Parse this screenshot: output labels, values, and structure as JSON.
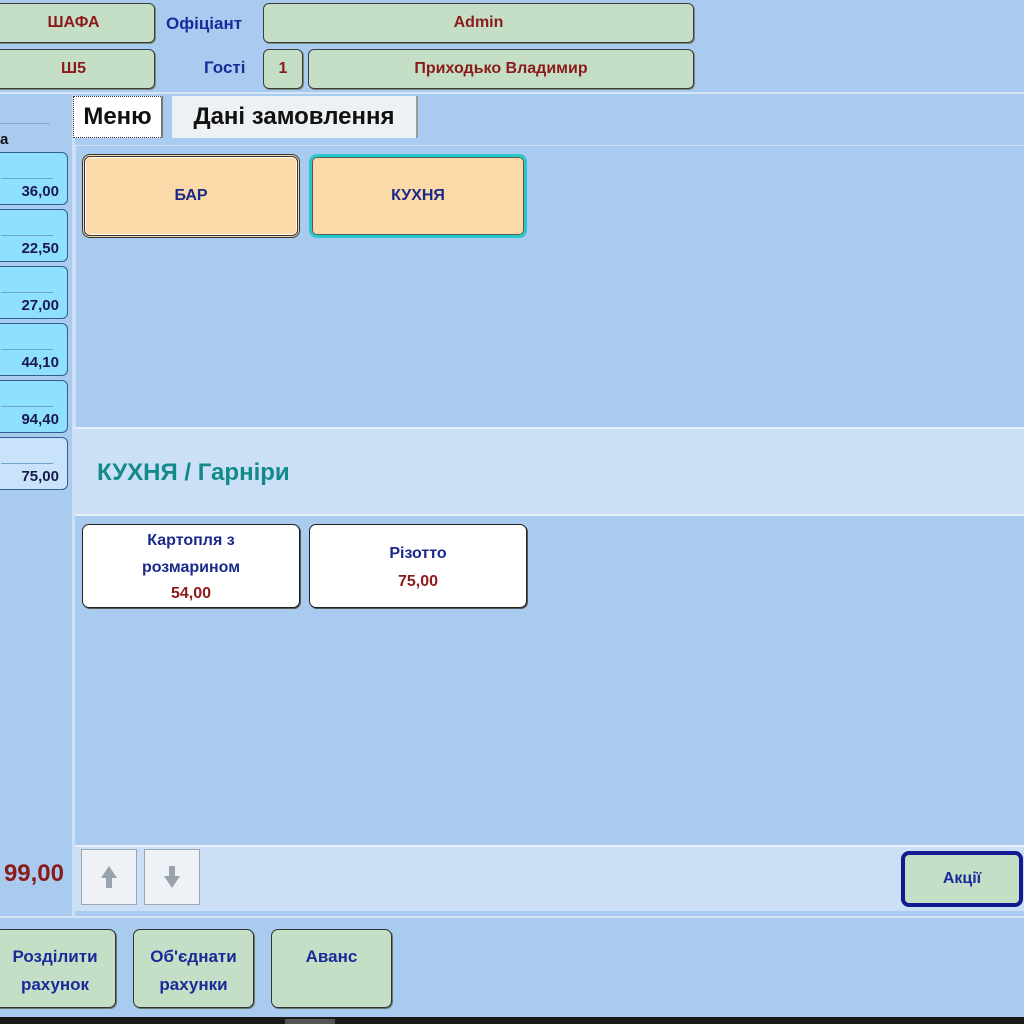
{
  "header": {
    "location_button": "ШАФА",
    "waiter_label": "Офіціант",
    "waiter_value": "Admin",
    "table_button": "Ш5",
    "guests_label": "Гості",
    "guests_value": "1",
    "client_button": "Приходько Владимир"
  },
  "order_list": {
    "column_header": "а",
    "items": [
      {
        "amount": "36,00"
      },
      {
        "amount": "22,50"
      },
      {
        "amount": "27,00"
      },
      {
        "amount": "44,10"
      },
      {
        "amount": "94,40"
      },
      {
        "amount": "75,00"
      }
    ],
    "total": "99,00"
  },
  "tabs": [
    {
      "label": "Меню",
      "active": true
    },
    {
      "label": "Дані замовлення",
      "active": false
    }
  ],
  "categories": [
    {
      "label": "БАР",
      "selected": false
    },
    {
      "label": "КУХНЯ",
      "selected": true
    }
  ],
  "breadcrumb": "КУХНЯ / Гарніри",
  "dishes": [
    {
      "name_line1": "Картопля з",
      "name_line2": "розмарином",
      "price": "54,00"
    },
    {
      "name_line1": "Різотто",
      "price": "75,00"
    }
  ],
  "nav": {
    "up_icon": "arrow-up-icon",
    "down_icon": "arrow-down-icon",
    "actions_label": "Акції"
  },
  "bottom_buttons": {
    "split_line1": "Розділити",
    "split_line2": "рахунок",
    "merge_line1": "Об'єднати",
    "merge_line2": "рахунки",
    "advance": "Аванс"
  },
  "colors": {
    "background": "#a9cbef",
    "green_button": "#c5dfc6",
    "category_button": "#fbd9a8",
    "selected_outline": "#27c8c8",
    "order_card": "#8fe0ff",
    "price_red": "#8b1a1a",
    "label_blue": "#1a2a9a",
    "breadcrumb_teal": "#138a8a"
  }
}
